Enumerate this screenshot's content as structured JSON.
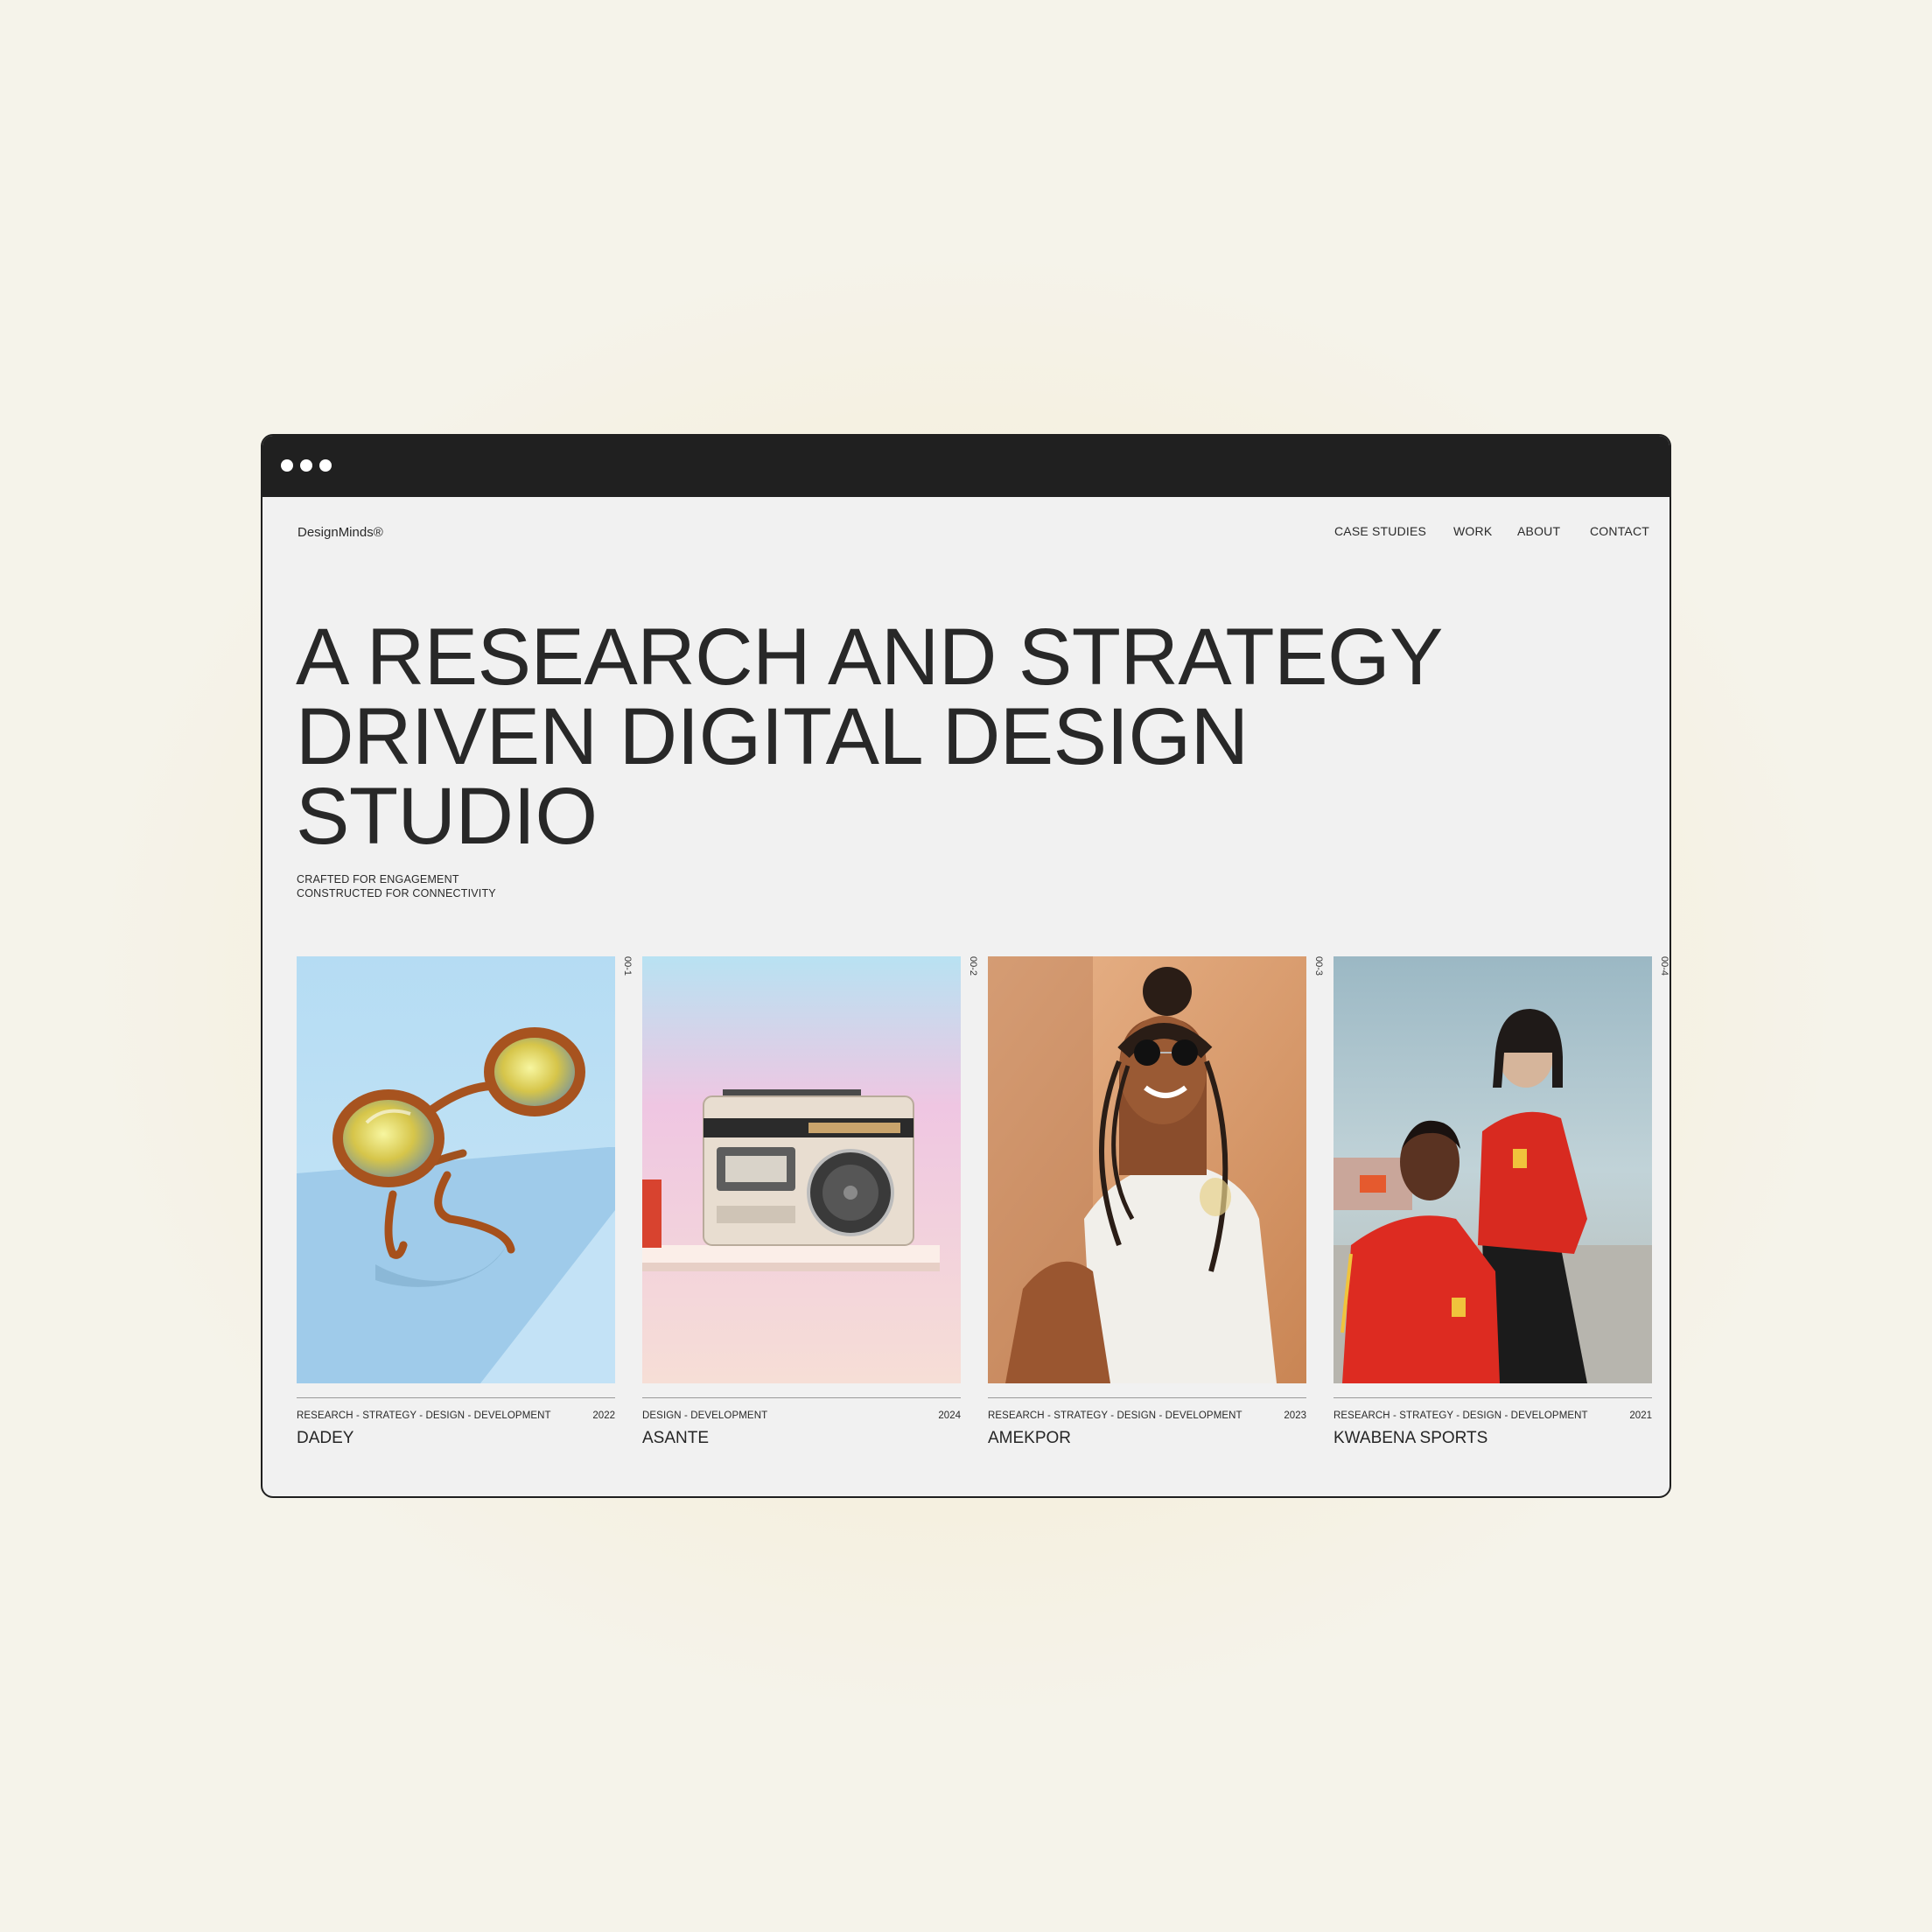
{
  "browser": {
    "window_controls": [
      "dot",
      "dot",
      "dot"
    ]
  },
  "header": {
    "logo": "DesignMinds®",
    "nav": [
      {
        "label": "CASE STUDIES"
      },
      {
        "label": "WORK"
      },
      {
        "label": "ABOUT"
      },
      {
        "label": "CONTACT"
      }
    ]
  },
  "hero": {
    "headline_lines": [
      "A RESEARCH AND STRATEGY",
      "DRIVEN DIGITAL DESIGN",
      "STUDIO"
    ],
    "tagline_lines": [
      "CRAFTED  FOR ENGAGEMENT",
      "CONSTRUCTED  FOR CONNECTIVITY"
    ]
  },
  "projects": [
    {
      "index": "00-1",
      "tags": "RESEARCH  - STRATEGY  - DESIGN  - DEVELOPMENT",
      "year": "2022",
      "name": "DADEY",
      "image": "sunglasses on blue background"
    },
    {
      "index": "00-2",
      "tags": "DESIGN  - DEVELOPMENT",
      "year": "2024",
      "name": "ASANTE",
      "image": "vintage cassette radio on pastel background"
    },
    {
      "index": "00-3",
      "tags": "RESEARCH  - STRATEGY  - DESIGN  - DEVELOPMENT",
      "year": "2023",
      "name": "AMEKPOR",
      "image": "smiling woman with braids and round sunglasses"
    },
    {
      "index": "00-4",
      "tags": "RESEARCH  - STRATEGY  - DESIGN  - DEVELOPMENT",
      "year": "2021",
      "name": "KWABENA SPORTS",
      "image": "two people in red football jerseys"
    }
  ]
}
